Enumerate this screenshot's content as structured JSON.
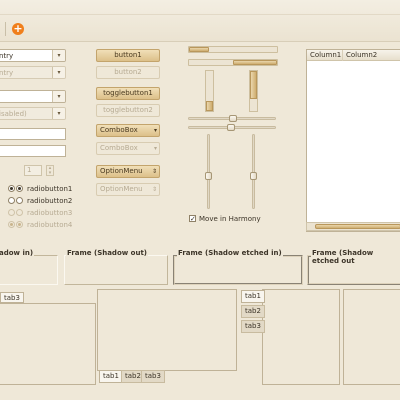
{
  "toolbar": {
    "add_icon": "add-icon",
    "separator": "toolbar-separator"
  },
  "combos": {
    "entry_combo_value": "ntry",
    "entry_combo_disabled_value": "ntry",
    "combo_empty": "",
    "combo_disabled_value": "isabled)",
    "text_entry_value": "",
    "text_entry_disabled_value": ""
  },
  "spin": {
    "value": "1"
  },
  "radios_left": [
    {
      "label": "n1",
      "checked": true,
      "disabled": false
    },
    {
      "label": "n2",
      "checked": false,
      "disabled": false
    },
    {
      "label": "n3",
      "checked": false,
      "disabled": true
    },
    {
      "label": "n4",
      "checked": true,
      "disabled": true
    }
  ],
  "radios_right": [
    {
      "label": "radiobutton1",
      "checked": true,
      "disabled": false
    },
    {
      "label": "radiobutton2",
      "checked": false,
      "disabled": false
    },
    {
      "label": "radiobutton3",
      "checked": false,
      "disabled": true
    },
    {
      "label": "radiobutton4",
      "checked": true,
      "disabled": true
    }
  ],
  "buttons": {
    "button1": "button1",
    "button2": "button2",
    "togglebutton1": "togglebutton1",
    "togglebutton2": "togglebutton2",
    "combobox1": "ComboBox",
    "combobox2": "ComboBox",
    "optionmenu1": "OptionMenu",
    "optionmenu2": "OptionMenu"
  },
  "progress": {
    "h1": 0.45,
    "h2": 0.8,
    "v1": 0.25,
    "v2": 0.7
  },
  "scales": {
    "h1": 0.5,
    "h2": 0.48,
    "v1": 0.55,
    "v2": 0.55
  },
  "harmony": {
    "label": "Move in Harmony",
    "checked": true
  },
  "tree": {
    "columns": [
      "Column1",
      "Column2"
    ]
  },
  "frames": {
    "in": "adow in)",
    "out": "Frame (Shadow out)",
    "etched_in": "Frame (Shadow etched in)",
    "etched_out": "Frame (Shadow etched out"
  },
  "notebook_left": {
    "tab": "tab3"
  },
  "notebook_bottom": {
    "tabs": [
      "tab1",
      "tab2",
      "tab3"
    ]
  },
  "notebook_side": {
    "tabs": [
      "tab1",
      "tab2",
      "tab3"
    ]
  }
}
